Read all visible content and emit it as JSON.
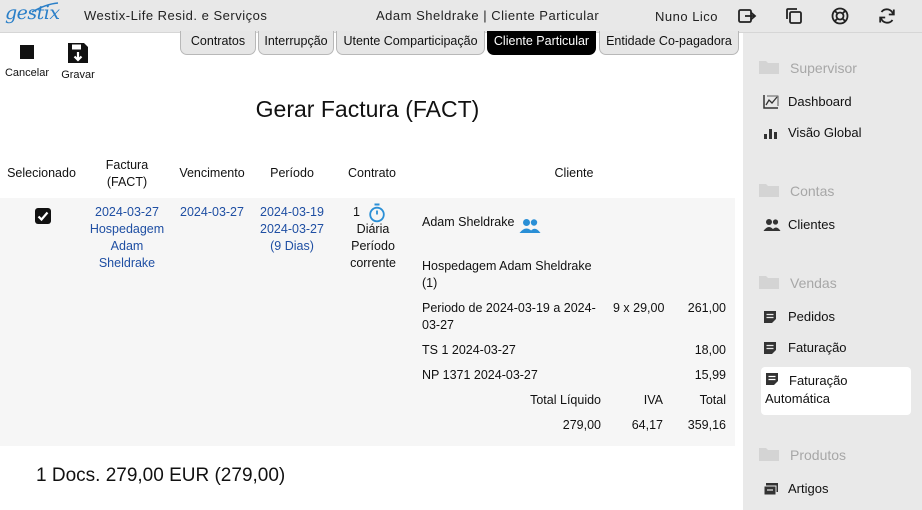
{
  "topbar": {
    "logo": "gestix",
    "company": "Westix-Life Resid. e Serviços",
    "context": "Adam Sheldrake | Cliente Particular",
    "user": "Nuno Lico",
    "icons": [
      "logout-icon",
      "windows-icon",
      "help-lifebuoy-icon",
      "refresh-icon"
    ]
  },
  "tabs": [
    {
      "label": "Contratos",
      "active": false
    },
    {
      "label": "Interrupção",
      "active": false
    },
    {
      "label": "Utente Comparticipação",
      "active": false
    },
    {
      "label": "Cliente Particular",
      "active": true
    },
    {
      "label": "Entidade Co-pagadora",
      "active": false
    }
  ],
  "toolbar": {
    "cancel_label": "Cancelar",
    "save_label": "Gravar"
  },
  "page_title": "Gerar Factura (FACT)",
  "table": {
    "headers": {
      "selected": "Selecionado",
      "invoice_l1": "Factura",
      "invoice_l2": "(FACT)",
      "due": "Vencimento",
      "period": "Período",
      "contract": "Contrato",
      "client": "Cliente"
    },
    "row": {
      "selected": true,
      "invoice_date": "2024-03-27",
      "invoice_desc_l1": "Hospedagem",
      "invoice_desc_l2": "Adam",
      "invoice_desc_l3": "Sheldrake",
      "due_date": "2024-03-27",
      "period_start": "2024-03-19",
      "period_end": "2024-03-27",
      "period_days": "(9 Dias)",
      "contract_number": "1",
      "contract_type": "Diária",
      "contract_period_l1": "Período",
      "contract_period_l2": "corrente",
      "client_name": "Adam Sheldrake",
      "lines": {
        "heading_l1": "Hospedagem Adam Sheldrake",
        "heading_l2": "(1)",
        "period_l1": "Periodo de 2024-03-19 a 2024-",
        "period_l2": "03-27",
        "period_qty": "9 x 29,00",
        "period_amount": "261,00",
        "ts_desc": "TS 1 2024-03-27",
        "ts_amount": "18,00",
        "np_desc": "NP 1371 2024-03-27",
        "np_amount": "15,99"
      },
      "totals": {
        "net_label": "Total Líquido",
        "vat_label": "IVA",
        "total_label": "Total",
        "net": "279,00",
        "vat": "64,17",
        "total": "359,16"
      }
    }
  },
  "footer_summary": "1 Docs. 279,00 EUR (279,00)",
  "sidebar": {
    "sections": [
      {
        "label": "Supervisor",
        "items": [
          "Dashboard",
          "Visão Global"
        ]
      },
      {
        "label": "Contas",
        "items": [
          "Clientes"
        ]
      },
      {
        "label": "Vendas",
        "items": [
          "Pedidos",
          "Faturação",
          "Faturação Automática"
        ]
      },
      {
        "label": "Produtos",
        "items": [
          "Artigos"
        ]
      }
    ],
    "active_item": "Faturação Automática",
    "active_l1": "Faturação",
    "active_l2": "Automática"
  },
  "colors": {
    "link": "#1f4fa3",
    "accent_icon": "#2a8fd6",
    "tab_active_bg": "#000000",
    "sidebar_bg": "#e9e9e9"
  }
}
